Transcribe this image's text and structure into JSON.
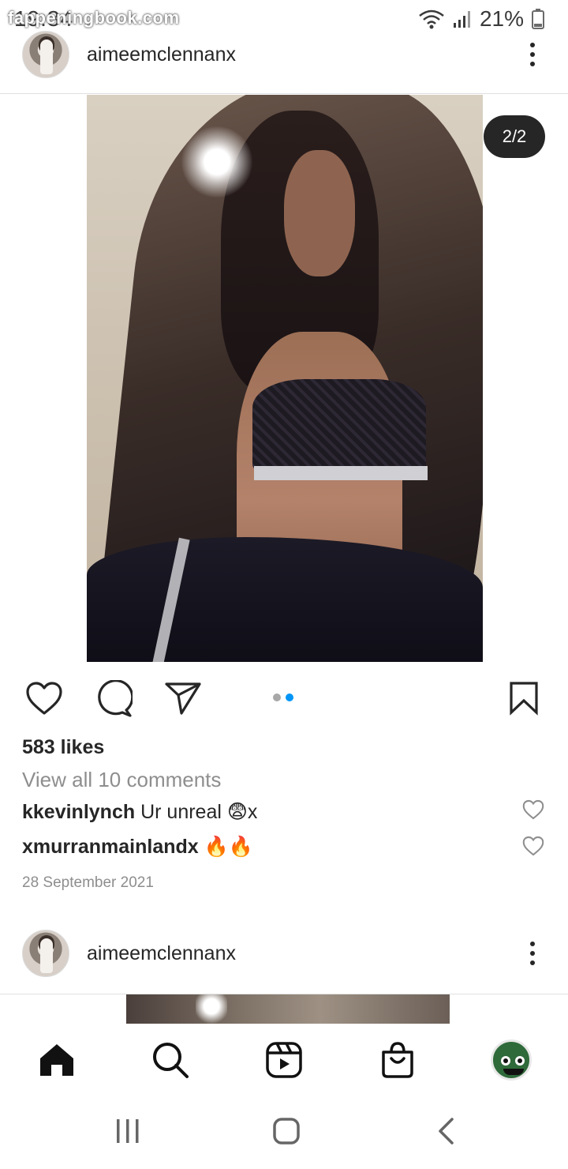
{
  "status_bar": {
    "time": "19:34",
    "watermark": "fappeningbook.com",
    "battery_percent": "21%",
    "icons": [
      "wifi-icon",
      "signal-icon",
      "battery-icon"
    ]
  },
  "post": {
    "username": "aimeemclennanx",
    "carousel_counter": "2/2",
    "carousel_position": {
      "current": 2,
      "total": 2
    },
    "likes": "583 likes",
    "view_comments": "View all 10 comments",
    "comments": [
      {
        "user": "kkevinlynch",
        "text": " Ur unreal 😨x"
      },
      {
        "user": "xmurranmainlandx",
        "text": " 🔥🔥"
      }
    ],
    "date": "28 September 2021",
    "actions": [
      "heart-icon",
      "comment-icon",
      "share-icon",
      "bookmark-icon"
    ]
  },
  "next_post": {
    "username": "aimeemclennanx"
  },
  "bottom_nav": [
    "home-icon",
    "search-icon",
    "reels-icon",
    "shop-icon",
    "profile-avatar"
  ],
  "system_nav": [
    "recents-icon",
    "home-circle-icon",
    "back-icon"
  ],
  "colors": {
    "text": "#262626",
    "secondary_text": "#8e8e8e",
    "accent": "#0095f6",
    "divider": "#e0e0e0"
  }
}
